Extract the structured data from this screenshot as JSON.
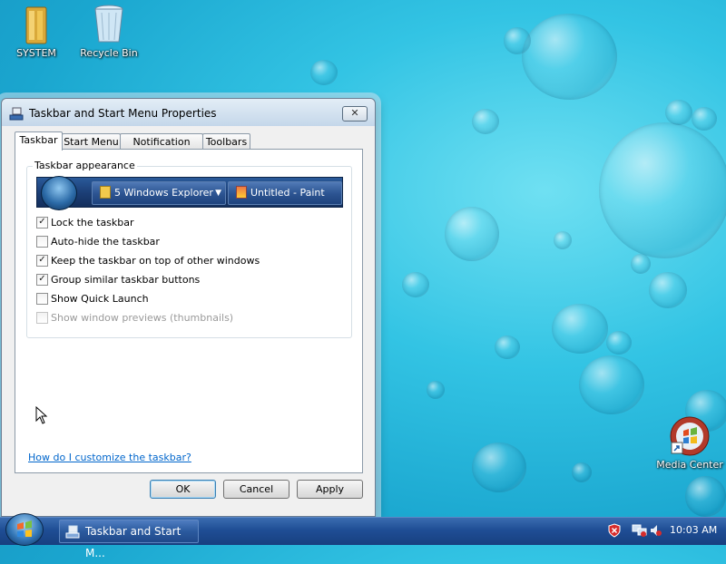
{
  "desktop": {
    "icons": [
      {
        "label": "SYSTEM",
        "icon": "folder-icon"
      },
      {
        "label": "Recycle Bin",
        "icon": "recycle-bin-icon"
      },
      {
        "label": "Media Center",
        "icon": "media-center-icon"
      }
    ]
  },
  "dialog": {
    "title": "Taskbar and Start Menu Properties",
    "close_label": "✕",
    "tabs": [
      {
        "label": "Taskbar",
        "active": true
      },
      {
        "label": "Start Menu",
        "active": false
      },
      {
        "label": "Notification Area",
        "active": false
      },
      {
        "label": "Toolbars",
        "active": false
      }
    ],
    "group_title": "Taskbar appearance",
    "preview": {
      "button1": "5 Windows Explorer",
      "button2": "Untitled - Paint"
    },
    "options": [
      {
        "label": "Lock the taskbar",
        "checked": true,
        "enabled": true
      },
      {
        "label": "Auto-hide the taskbar",
        "checked": false,
        "enabled": true
      },
      {
        "label": "Keep the taskbar on top of other windows",
        "checked": true,
        "enabled": true
      },
      {
        "label": "Group similar taskbar buttons",
        "checked": true,
        "enabled": true
      },
      {
        "label": "Show Quick Launch",
        "checked": false,
        "enabled": true
      },
      {
        "label": "Show window previews (thumbnails)",
        "checked": false,
        "enabled": false
      }
    ],
    "help_link": "How do I customize the taskbar?",
    "buttons": {
      "ok": "OK",
      "cancel": "Cancel",
      "apply": "Apply"
    }
  },
  "taskbar": {
    "window_button": "Taskbar and Start M...",
    "clock": "10:03 AM"
  }
}
